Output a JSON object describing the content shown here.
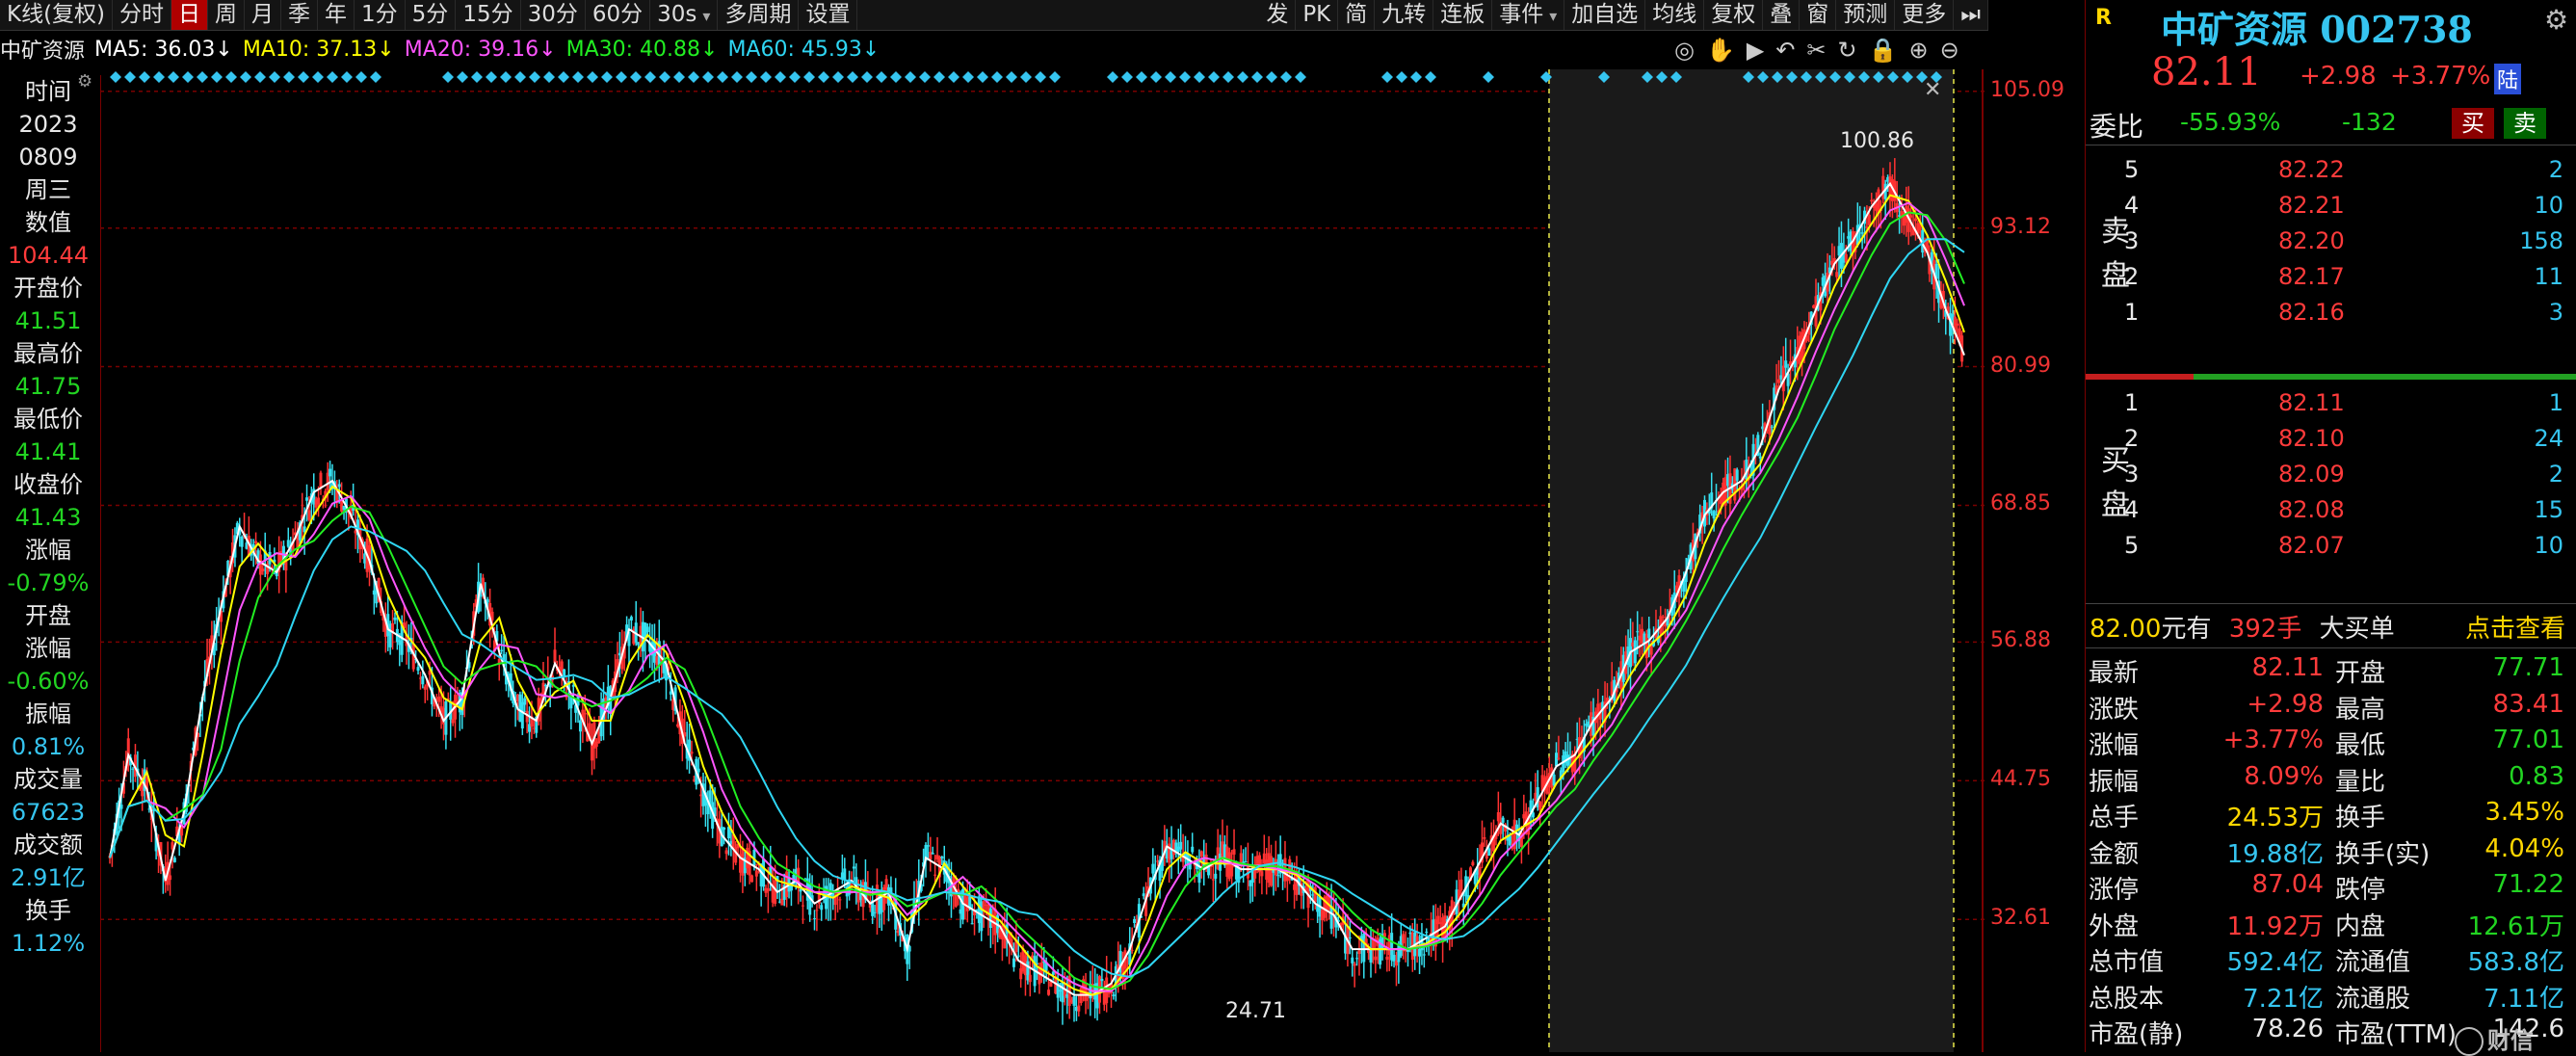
{
  "toolbar": {
    "items": [
      "K线(复权)",
      "分时",
      "日",
      "周",
      "月",
      "季",
      "年",
      "1分",
      "5分",
      "15分",
      "30分",
      "60分",
      "30s",
      "多周期",
      "设置"
    ],
    "right_items": [
      "发",
      "PK",
      "简",
      "九转",
      "连板",
      "事件",
      "加自选",
      "均线",
      "复权",
      "叠",
      "窗",
      "预测",
      "更多"
    ]
  },
  "ma_bar": {
    "name": "中矿资源",
    "ma5": "MA5: 36.03↓",
    "ma10": "MA10: 37.13↓",
    "ma20": "MA20: 39.16↓",
    "ma30": "MA30: 40.88↓",
    "ma60": "MA60: 45.93↓",
    "colors": {
      "ma5": "#ffffff",
      "ma10": "#ffff00",
      "ma20": "#ff55ff",
      "ma30": "#22ee22",
      "ma60": "#2fd6f3"
    }
  },
  "left_panel": {
    "rows": [
      {
        "text": "时间",
        "color": "#e8e8e8"
      },
      {
        "text": "2023",
        "color": "#e8e8e8"
      },
      {
        "text": "0809",
        "color": "#e8e8e8"
      },
      {
        "text": "周三",
        "color": "#e8e8e8"
      },
      {
        "text": "数值",
        "color": "#e8e8e8"
      },
      {
        "text": "104.44",
        "color": "#ff3b3b"
      },
      {
        "text": "开盘价",
        "color": "#e8e8e8"
      },
      {
        "text": "41.51",
        "color": "#22d422"
      },
      {
        "text": "最高价",
        "color": "#e8e8e8"
      },
      {
        "text": "41.75",
        "color": "#22d422"
      },
      {
        "text": "最低价",
        "color": "#e8e8e8"
      },
      {
        "text": "41.41",
        "color": "#22d422"
      },
      {
        "text": "收盘价",
        "color": "#e8e8e8"
      },
      {
        "text": "41.43",
        "color": "#22d422"
      },
      {
        "text": "涨幅",
        "color": "#e8e8e8"
      },
      {
        "text": "-0.79%",
        "color": "#22d422"
      },
      {
        "text": "开盘",
        "color": "#e8e8e8"
      },
      {
        "text": "涨幅",
        "color": "#e8e8e8"
      },
      {
        "text": "-0.60%",
        "color": "#22d422"
      },
      {
        "text": "振幅",
        "color": "#e8e8e8"
      },
      {
        "text": "0.81%",
        "color": "#36c5f0"
      },
      {
        "text": "成交量",
        "color": "#e8e8e8"
      },
      {
        "text": "67623",
        "color": "#36c5f0"
      },
      {
        "text": "成交额",
        "color": "#e8e8e8"
      },
      {
        "text": "2.91亿",
        "color": "#36c5f0"
      },
      {
        "text": "换手",
        "color": "#e8e8e8"
      },
      {
        "text": "1.12%",
        "color": "#36c5f0"
      }
    ]
  },
  "price_axis": [
    "105.09",
    "93.12",
    "80.99",
    "68.85",
    "56.88",
    "44.75",
    "32.61"
  ],
  "chart_annotations": {
    "high": "100.86",
    "low": "24.71"
  },
  "quote": {
    "badge": "R",
    "title": "中矿资源 002738",
    "price": "82.11",
    "change": "+2.98",
    "change_pct": "+3.77%",
    "tag": "陆",
    "weibi_label": "委比",
    "weibi_pct": "-55.93%",
    "weibi_num": "-132",
    "buy_btn": "买",
    "sell_btn": "卖",
    "sell_label": "卖盘",
    "buy_label": "买盘",
    "asks": [
      {
        "lvl": "5",
        "price": "82.22",
        "vol": "2"
      },
      {
        "lvl": "4",
        "price": "82.21",
        "vol": "10"
      },
      {
        "lvl": "3",
        "price": "82.20",
        "vol": "158"
      },
      {
        "lvl": "2",
        "price": "82.17",
        "vol": "11"
      },
      {
        "lvl": "1",
        "price": "82.16",
        "vol": "3"
      }
    ],
    "bids": [
      {
        "lvl": "1",
        "price": "82.11",
        "vol": "1"
      },
      {
        "lvl": "2",
        "price": "82.10",
        "vol": "24"
      },
      {
        "lvl": "3",
        "price": "82.09",
        "vol": "2"
      },
      {
        "lvl": "4",
        "price": "82.08",
        "vol": "15"
      },
      {
        "lvl": "5",
        "price": "82.07",
        "vol": "10"
      }
    ],
    "big_order": {
      "price": "82.00",
      "unit": "元有",
      "qty": "392手",
      "label": "大买单",
      "link": "点击查看"
    },
    "stats": [
      {
        "l1": "最新",
        "v1": "82.11",
        "c1": "#ff3b3b",
        "l2": "开盘",
        "v2": "77.71",
        "c2": "#22d422"
      },
      {
        "l1": "涨跌",
        "v1": "+2.98",
        "c1": "#ff3b3b",
        "l2": "最高",
        "v2": "83.41",
        "c2": "#ff3b3b"
      },
      {
        "l1": "涨幅",
        "v1": "+3.77%",
        "c1": "#ff3b3b",
        "l2": "最低",
        "v2": "77.01",
        "c2": "#22d422"
      },
      {
        "l1": "振幅",
        "v1": "8.09%",
        "c1": "#ff3b3b",
        "l2": "量比",
        "v2": "0.83",
        "c2": "#22d422"
      },
      {
        "l1": "总手",
        "v1": "24.53万",
        "c1": "#ffd700",
        "l2": "换手",
        "v2": "3.45%",
        "c2": "#ffd700"
      },
      {
        "l1": "金额",
        "v1": "19.88亿",
        "c1": "#36c5f0",
        "l2": "换手(实)",
        "v2": "4.04%",
        "c2": "#ffd700"
      },
      {
        "l1": "涨停",
        "v1": "87.04",
        "c1": "#ff3b3b",
        "l2": "跌停",
        "v2": "71.22",
        "c2": "#22d422"
      },
      {
        "l1": "外盘",
        "v1": "11.92万",
        "c1": "#ff3b3b",
        "l2": "内盘",
        "v2": "12.61万",
        "c2": "#22d422"
      },
      {
        "l1": "总市值",
        "v1": "592.4亿",
        "c1": "#36c5f0",
        "l2": "流通值",
        "v2": "583.8亿",
        "c2": "#36c5f0"
      },
      {
        "l1": "总股本",
        "v1": "7.21亿",
        "c1": "#36c5f0",
        "l2": "流通股",
        "v2": "7.11亿",
        "c2": "#36c5f0"
      },
      {
        "l1": "市盈(静)",
        "v1": "78.26",
        "c1": "#e8e8e8",
        "l2": "市盈(TTM)",
        "v2": "142.6",
        "c2": "#e8e8e8"
      }
    ],
    "watermark": "财信"
  },
  "chart_data": {
    "type": "line",
    "title": "中矿资源",
    "ylabel": "",
    "ylim": [
      22,
      106
    ],
    "x": [
      0,
      10,
      20,
      30,
      40,
      50,
      60,
      70,
      80,
      90,
      100,
      110,
      120,
      130,
      140,
      150,
      160,
      170,
      180,
      190,
      200,
      210,
      220,
      230,
      240,
      250,
      260,
      270,
      280,
      290,
      300,
      310,
      320,
      330,
      340,
      350,
      360,
      370,
      380,
      390,
      400,
      410,
      420,
      430,
      440,
      450,
      460,
      470,
      480,
      490,
      500,
      510,
      520,
      530,
      540,
      550,
      560,
      570,
      580,
      590,
      600,
      610,
      620,
      630,
      640,
      650,
      660,
      670,
      680,
      690,
      700,
      710,
      720,
      730,
      740,
      750,
      760,
      770,
      780,
      790,
      800,
      810,
      820,
      830,
      840,
      850,
      860,
      870,
      880,
      890,
      900,
      910,
      920,
      930,
      940,
      950,
      960,
      970,
      980,
      990,
      1000
    ],
    "series": [
      {
        "name": "MA5",
        "values": [
          36.03
        ]
      },
      {
        "name": "MA10",
        "values": [
          37.13
        ]
      },
      {
        "name": "MA20",
        "values": [
          39.16
        ]
      },
      {
        "name": "MA30",
        "values": [
          40.88
        ]
      },
      {
        "name": "MA60",
        "values": [
          45.93
        ]
      }
    ],
    "price": [
      38,
      47,
      44,
      36,
      42,
      52,
      60,
      67,
      64,
      63,
      66,
      70,
      71,
      68,
      64,
      58,
      57,
      54,
      50,
      52,
      62,
      56,
      51,
      50,
      55,
      52,
      48,
      52,
      58,
      57,
      55,
      48,
      44,
      40,
      38,
      37,
      35,
      36,
      34,
      35,
      36,
      34,
      35,
      30,
      38,
      37,
      34,
      33,
      32,
      29,
      28,
      27,
      26,
      26,
      27,
      30,
      35,
      39,
      38,
      37,
      38,
      37,
      37,
      37,
      36,
      34,
      33,
      30,
      30,
      30,
      30,
      31,
      32,
      35,
      38,
      41,
      40,
      43,
      46,
      47,
      50,
      52,
      56,
      57,
      59,
      63,
      68,
      70,
      71,
      74,
      79,
      82,
      86,
      90,
      92,
      95,
      97,
      94,
      91,
      86,
      82
    ]
  }
}
